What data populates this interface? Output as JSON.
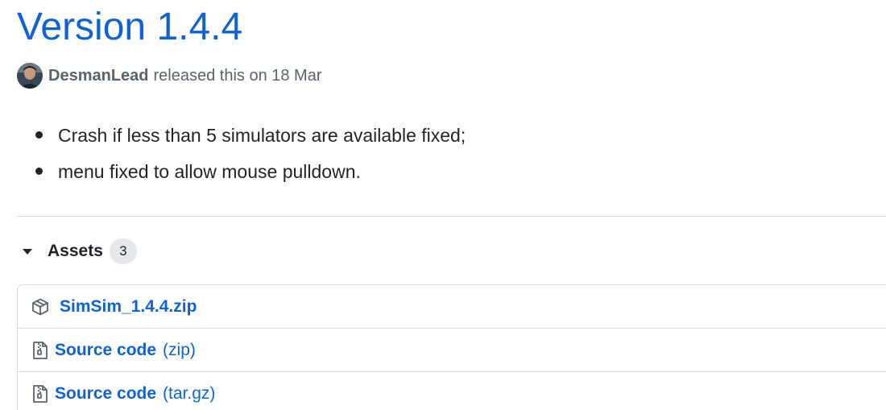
{
  "release": {
    "title": "Version 1.4.4",
    "author": "DesmanLead",
    "released_text": "released this on 18 Mar"
  },
  "notes": [
    "Crash if less than 5 simulators are available fixed;",
    "menu fixed to allow mouse pulldown."
  ],
  "assets": {
    "label": "Assets",
    "count": "3",
    "items": [
      {
        "name": "SimSim_1.4.4.zip",
        "suffix": "",
        "icon": "package-icon"
      },
      {
        "name": "Source code",
        "suffix": "(zip)",
        "icon": "file-zip-icon"
      },
      {
        "name": "Source code",
        "suffix": "(tar.gz)",
        "icon": "file-zip-icon"
      }
    ]
  },
  "colors": {
    "link": "#0f62d6",
    "muted": "#59636e",
    "border": "#d8dee4",
    "counter_bg": "#e6e9ec"
  }
}
